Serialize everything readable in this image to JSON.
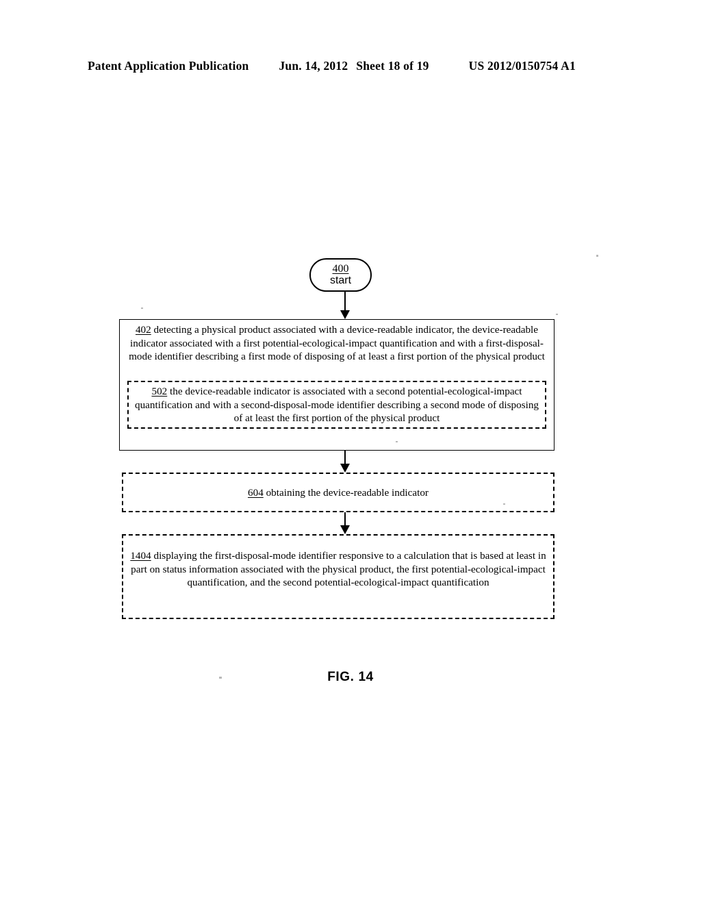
{
  "header": {
    "left": "Patent Application Publication",
    "date": "Jun. 14, 2012",
    "sheet": "Sheet 18 of 19",
    "pub_number": "US 2012/0150754 A1"
  },
  "figure": {
    "caption": "FIG. 14",
    "start_node": {
      "ref": "400",
      "label": "start"
    },
    "steps": [
      {
        "ref": "402",
        "border": "solid",
        "text": "detecting a physical product associated with a device-readable indicator, the device-readable indicator associated with a first potential-ecological-impact quantification and with a first-disposal-mode identifier describing a first mode of disposing of at least a first portion of the physical product"
      },
      {
        "ref": "502",
        "border": "dashed",
        "text": "the device-readable indicator is associated with a second potential-ecological-impact quantification and with a second-disposal-mode identifier describing a second mode of disposing of at least the first portion of the physical product"
      },
      {
        "ref": "604",
        "border": "dashed",
        "text": "obtaining the device-readable indicator"
      },
      {
        "ref": "1404",
        "border": "dashed",
        "text": "displaying the first-disposal-mode identifier responsive to a calculation that is based at least in part on status information associated with the physical product, the first potential-ecological-impact quantification, and the second potential-ecological-impact quantification"
      }
    ]
  }
}
